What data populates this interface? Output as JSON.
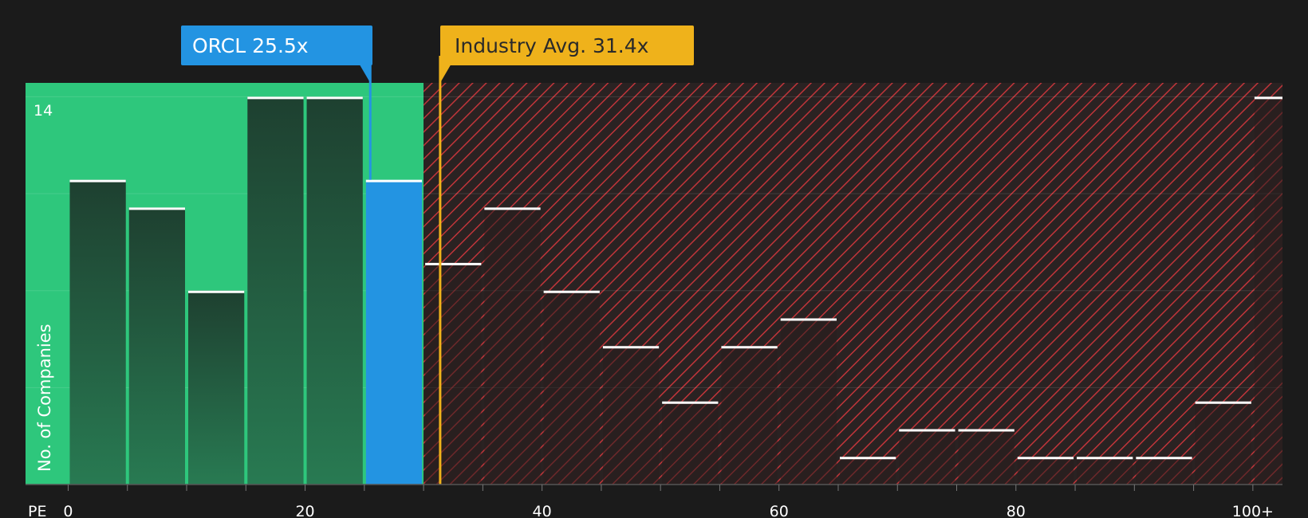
{
  "callouts": {
    "company": {
      "ticker": "ORCL",
      "value_label": "25.5x",
      "text": "ORCL 25.5x",
      "pe": 25.5
    },
    "industry": {
      "text": "Industry Avg. 31.4x",
      "pe": 31.4
    }
  },
  "colors": {
    "background": "#1b1b1b",
    "undervalued_zone": "#2ec77c",
    "overvalued_zone": "#2a2222",
    "hatch": "#c0353a",
    "company_bar": "#2394e2",
    "industry_line": "#efb21b",
    "bar_dark": "#1f4a36",
    "bar_top": "#ffffff"
  },
  "chart_data": {
    "type": "bar",
    "xlabel": "PE",
    "ylabel": "No. of Companies",
    "x_ticks": [
      {
        "value": 0,
        "label": "0"
      },
      {
        "value": 20,
        "label": "20"
      },
      {
        "value": 40,
        "label": "40"
      },
      {
        "value": 60,
        "label": "60"
      },
      {
        "value": 80,
        "label": "80"
      },
      {
        "value": 100,
        "label": "100+"
      }
    ],
    "y_tick_label": "14",
    "ylim": [
      0,
      14.5
    ],
    "xlim": [
      -3.6,
      102.5
    ],
    "fair_zone_max_pe": 30,
    "bins": [
      {
        "start": 0,
        "end": 5,
        "count": 11
      },
      {
        "start": 5,
        "end": 10,
        "count": 10
      },
      {
        "start": 10,
        "end": 15,
        "count": 7
      },
      {
        "start": 15,
        "end": 20,
        "count": 14
      },
      {
        "start": 20,
        "end": 25,
        "count": 14
      },
      {
        "start": 25,
        "end": 30,
        "count": 11,
        "highlight": true
      },
      {
        "start": 30,
        "end": 35,
        "count": 8
      },
      {
        "start": 35,
        "end": 40,
        "count": 10
      },
      {
        "start": 40,
        "end": 45,
        "count": 7
      },
      {
        "start": 45,
        "end": 50,
        "count": 5
      },
      {
        "start": 50,
        "end": 55,
        "count": 3
      },
      {
        "start": 55,
        "end": 60,
        "count": 5
      },
      {
        "start": 60,
        "end": 65,
        "count": 6
      },
      {
        "start": 65,
        "end": 70,
        "count": 1
      },
      {
        "start": 70,
        "end": 75,
        "count": 2
      },
      {
        "start": 75,
        "end": 80,
        "count": 2
      },
      {
        "start": 80,
        "end": 85,
        "count": 1
      },
      {
        "start": 85,
        "end": 90,
        "count": 1
      },
      {
        "start": 90,
        "end": 95,
        "count": 1
      },
      {
        "start": 95,
        "end": 100,
        "count": 3
      },
      {
        "start": 100,
        "end": 105,
        "count": 14
      }
    ]
  }
}
